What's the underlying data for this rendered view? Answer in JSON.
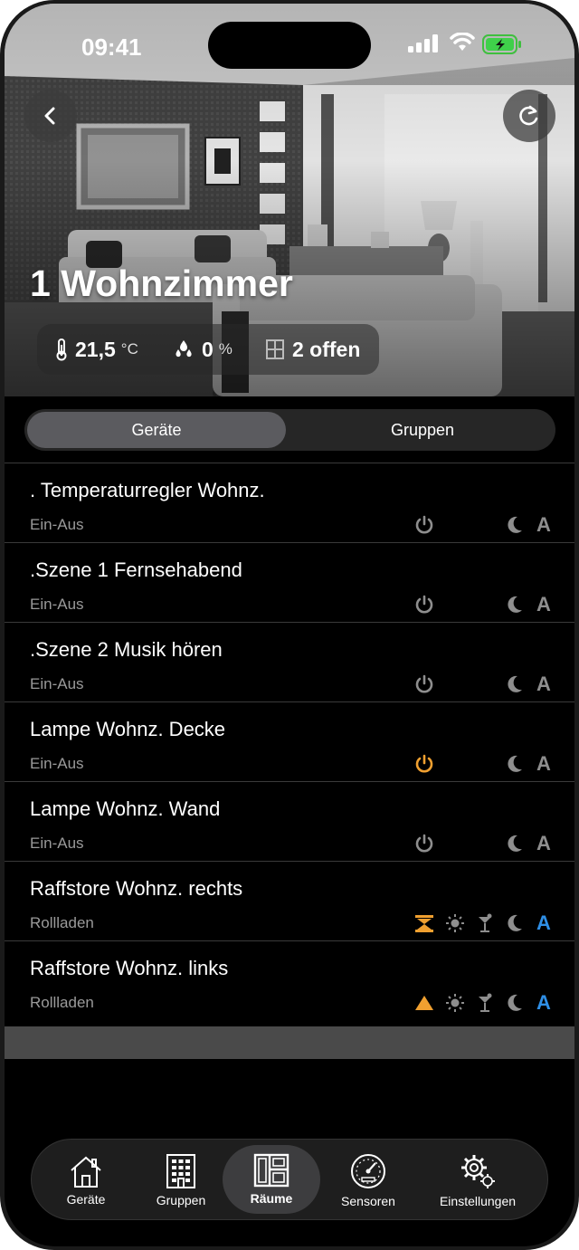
{
  "status_bar": {
    "time": "09:41"
  },
  "room": {
    "title": "1 Wohnzimmer",
    "temperature": {
      "value": "21,5",
      "unit": "°C"
    },
    "humidity": {
      "value": "0",
      "unit": "%"
    },
    "windows": {
      "value": "2 offen"
    }
  },
  "tabs": [
    {
      "label": "Geräte",
      "active": true
    },
    {
      "label": "Gruppen",
      "active": false
    }
  ],
  "devices": [
    {
      "name": ". Temperaturregler Wohnz.",
      "type": "Ein-Aus",
      "power_on": false
    },
    {
      "name": ".Szene 1 Fernsehabend",
      "type": "Ein-Aus",
      "power_on": false
    },
    {
      "name": ".Szene 2 Musik hören",
      "type": "Ein-Aus",
      "power_on": false
    },
    {
      "name": "Lampe Wohnz. Decke",
      "type": "Ein-Aus",
      "power_on": true
    },
    {
      "name": "Lampe Wohnz. Wand",
      "type": "Ein-Aus",
      "power_on": false
    },
    {
      "name": "Raffstore Wohnz.  rechts",
      "type": "Rollladen",
      "blind_state": "stopped"
    },
    {
      "name": "Raffstore Wohnz. links",
      "type": "Rollladen",
      "blind_state": "up"
    }
  ],
  "auto_label": "A",
  "nav": [
    {
      "label": "Geräte",
      "icon": "house-icon",
      "active": false
    },
    {
      "label": "Gruppen",
      "icon": "building-icon",
      "active": false
    },
    {
      "label": "Räume",
      "icon": "floorplan-icon",
      "active": true
    },
    {
      "label": "Sensoren",
      "icon": "gauge-icon",
      "active": false
    },
    {
      "label": "Einstellungen",
      "icon": "gears-icon",
      "active": false
    }
  ],
  "colors": {
    "accent_orange": "#f0a030",
    "accent_blue": "#2f8fe6",
    "icon_gray": "#8e8e8e"
  }
}
